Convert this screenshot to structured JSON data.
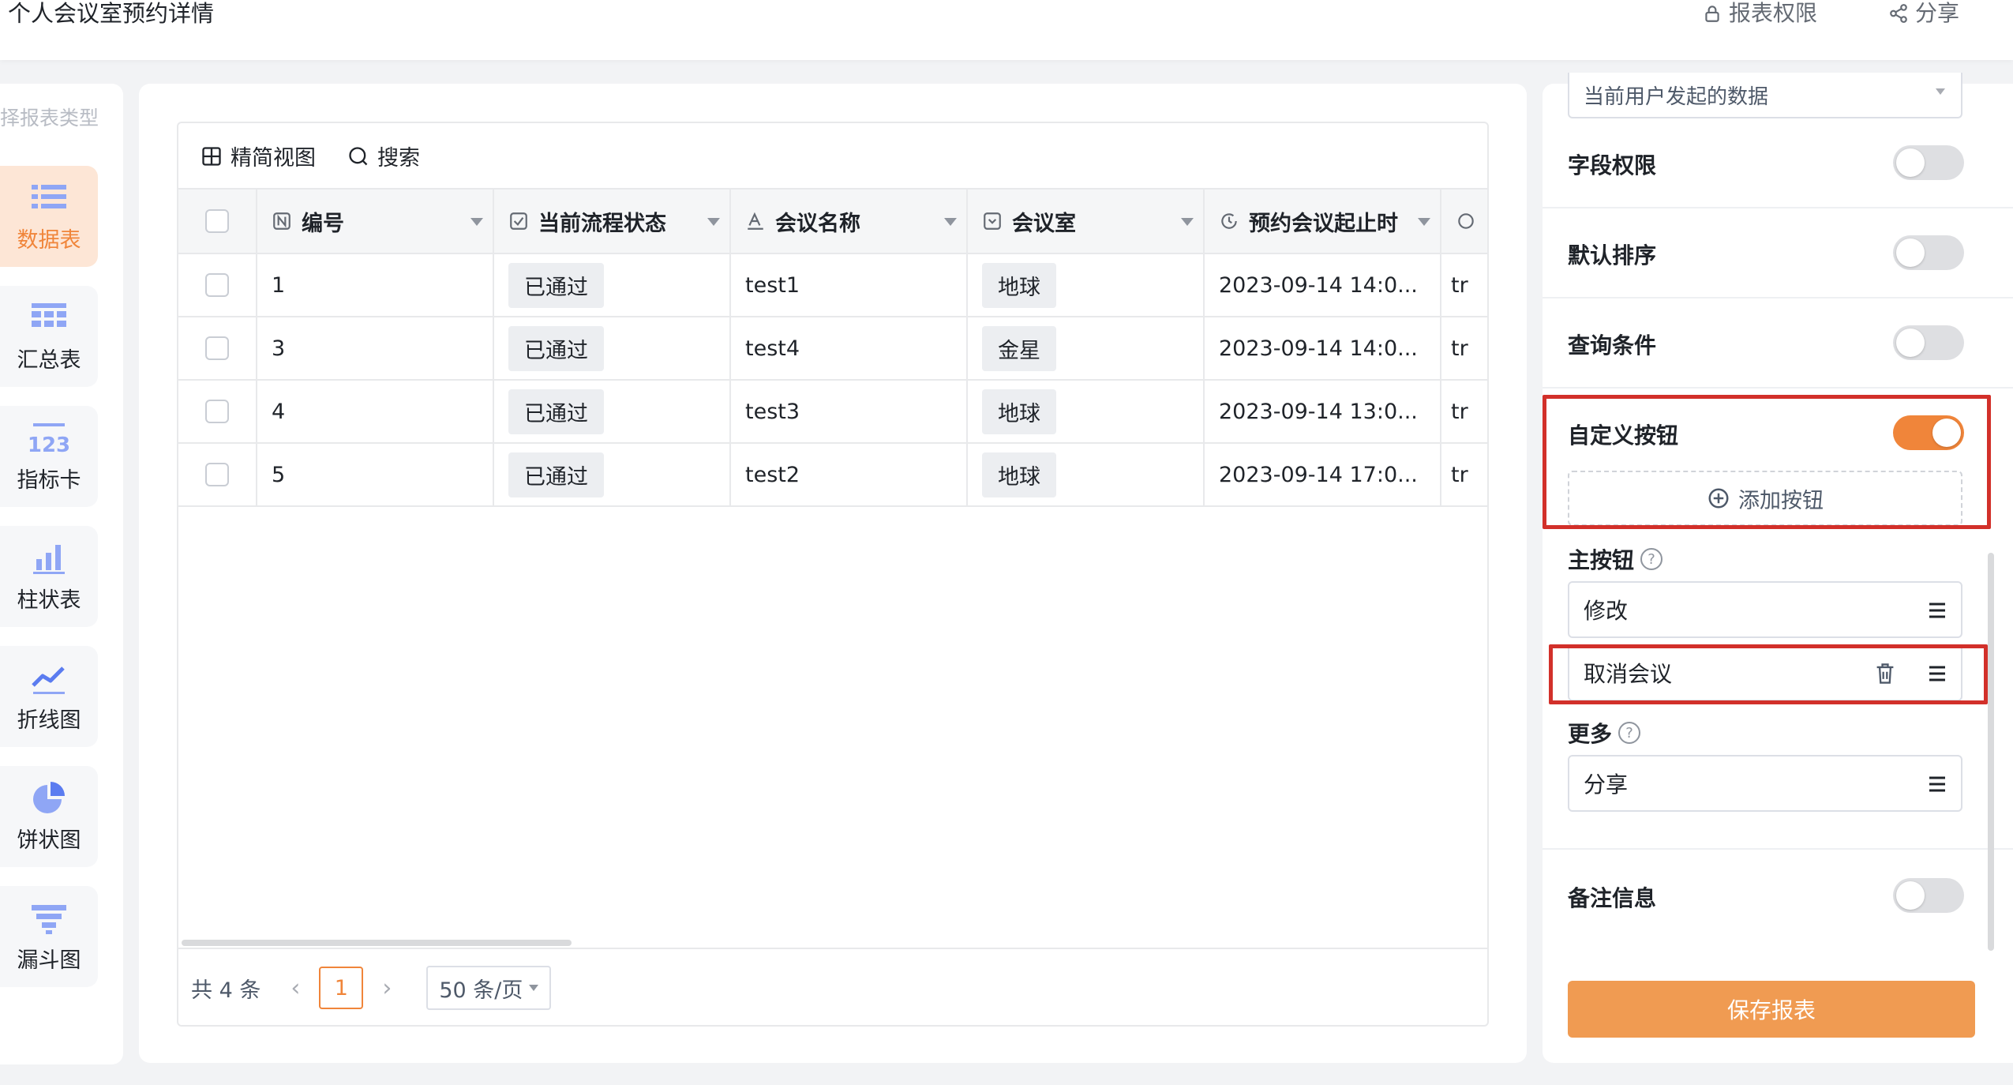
{
  "header": {
    "title": "个人会议室预约详情",
    "permission_label": "报表权限",
    "share_label": "分享"
  },
  "types": {
    "header": "择报表类型",
    "items": [
      {
        "label": "数据表",
        "icon": "list-icon",
        "active": true
      },
      {
        "label": "汇总表",
        "icon": "table-icon",
        "active": false
      },
      {
        "label": "指标卡",
        "icon": "number-icon",
        "active": false
      },
      {
        "label": "柱状表",
        "icon": "bar-chart-icon",
        "active": false
      },
      {
        "label": "折线图",
        "icon": "line-chart-icon",
        "active": false
      },
      {
        "label": "饼状图",
        "icon": "pie-chart-icon",
        "active": false
      },
      {
        "label": "漏斗图",
        "icon": "funnel-icon",
        "active": false
      }
    ]
  },
  "table": {
    "toolbar": {
      "compact_view": "精简视图",
      "search": "搜索"
    },
    "columns": [
      "编号",
      "当前流程状态",
      "会议名称",
      "会议室",
      "预约会议起止时"
    ],
    "rows": [
      {
        "id": "1",
        "status": "已通过",
        "name": "test1",
        "room": "地球",
        "time": "2023-09-14 14:0...",
        "extra": "tr"
      },
      {
        "id": "3",
        "status": "已通过",
        "name": "test4",
        "room": "金星",
        "time": "2023-09-14 14:0...",
        "extra": "tr"
      },
      {
        "id": "4",
        "status": "已通过",
        "name": "test3",
        "room": "地球",
        "time": "2023-09-14 13:0...",
        "extra": "tr"
      },
      {
        "id": "5",
        "status": "已通过",
        "name": "test2",
        "room": "地球",
        "time": "2023-09-14 17:0...",
        "extra": "tr"
      }
    ],
    "pagination": {
      "total": "共 4 条",
      "prev": "‹",
      "page": "1",
      "next": "›",
      "page_size": "50 条/页"
    }
  },
  "settings": {
    "data_scope_value": "当前用户发起的数据",
    "field_permission": {
      "label": "字段权限",
      "on": false
    },
    "default_sort": {
      "label": "默认排序",
      "on": false
    },
    "query_conditions": {
      "label": "查询条件",
      "on": false
    },
    "custom_buttons": {
      "label": "自定义按钮",
      "on": true
    },
    "add_button_label": "添加按钮",
    "primary_buttons_label": "主按钮",
    "primary_buttons": [
      "修改",
      "取消会议"
    ],
    "more_label": "更多",
    "more_buttons": [
      "分享"
    ],
    "remarks": {
      "label": "备注信息",
      "on": false
    },
    "save_label": "保存报表"
  },
  "colors": {
    "accent": "#f0853a",
    "highlight_box": "#d2302a"
  }
}
